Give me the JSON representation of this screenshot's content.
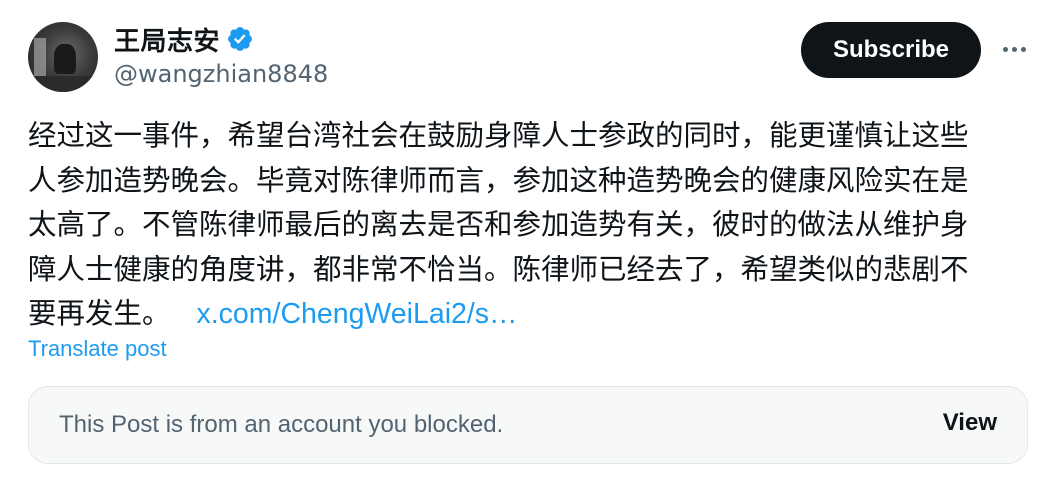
{
  "author": {
    "display_name": "王局志安",
    "handle": "@wangzhian8848",
    "verified_icon": "verified-badge-icon"
  },
  "actions": {
    "subscribe_label": "Subscribe",
    "more_icon": "more-options-icon"
  },
  "post": {
    "lines": [
      "经过这一事件，希望台湾社会在鼓励身障人士参政的同时，能更谨慎让这些",
      "人参加造势晚会。毕竟对陈律师而言，参加这种造势晚会的健康风险实在是",
      "太高了。不管陈律师最后的离去是否和参加造势有关，彼时的做法从维护身",
      "障人士健康的角度讲，都非常不恰当。陈律师已经去了，希望类似的悲剧不",
      "要再发生。"
    ],
    "link_text": "x.com/ChengWeiLai2/s…",
    "translate_label": "Translate post"
  },
  "quoted": {
    "blocked_message": "This Post is from an account you blocked.",
    "view_label": "View"
  },
  "colors": {
    "accent": "#1d9bf0",
    "text": "#0f1419",
    "secondary": "#536471",
    "box_bg": "#f7f9f9"
  }
}
